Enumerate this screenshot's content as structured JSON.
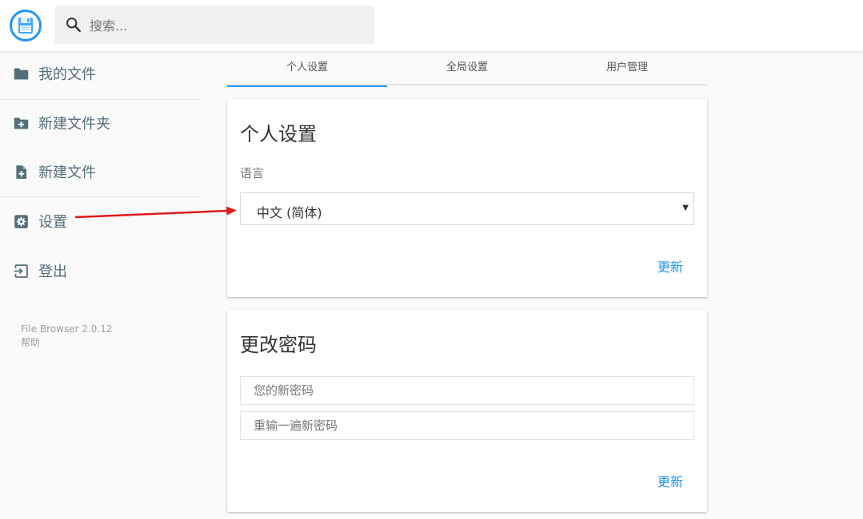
{
  "header": {
    "search_placeholder": "搜索...",
    "logo_icon": "floppy-disk-icon",
    "accent_color": "#2196f3"
  },
  "sidebar": {
    "items": [
      {
        "label": "我的文件",
        "icon": "folder-icon"
      },
      {
        "label": "新建文件夹",
        "icon": "folder-plus-icon"
      },
      {
        "label": "新建文件",
        "icon": "file-plus-icon"
      },
      {
        "label": "设置",
        "icon": "gear-icon"
      },
      {
        "label": "登出",
        "icon": "logout-icon"
      }
    ],
    "credits": {
      "version": "File Browser 2.0.12",
      "help": "帮助"
    }
  },
  "tabs": [
    {
      "label": "个人设置",
      "active": true
    },
    {
      "label": "全局设置",
      "active": false
    },
    {
      "label": "用户管理",
      "active": false
    }
  ],
  "profile_card": {
    "title": "个人设置",
    "language_label": "语言",
    "language_value": "中文 (简体)",
    "submit_label": "更新"
  },
  "password_card": {
    "title": "更改密码",
    "new_password_placeholder": "您的新密码",
    "confirm_password_placeholder": "重输一遍新密码",
    "submit_label": "更新"
  },
  "annotation": {
    "color": "#e01b1b"
  }
}
